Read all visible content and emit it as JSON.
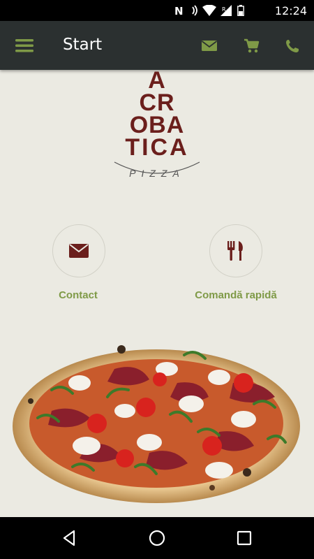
{
  "status_bar": {
    "time": "12:24",
    "icons": [
      "nfc-icon",
      "wifi-icon",
      "signal-roaming-icon",
      "battery-icon"
    ],
    "roaming_letter": "R"
  },
  "app_bar": {
    "title": "Start",
    "actions": [
      "mail-icon",
      "cart-icon",
      "phone-icon"
    ]
  },
  "logo": {
    "lines": [
      "A",
      "CR",
      "OBA",
      "TICA"
    ],
    "subtitle": "PIZZA"
  },
  "shortcuts": [
    {
      "icon": "envelope-icon",
      "label": "Contact"
    },
    {
      "icon": "cutlery-icon",
      "label": "Comandă rapidă"
    }
  ],
  "colors": {
    "app_bar": "#2b3030",
    "accent_green": "#7f9a47",
    "brand_maroon": "#6b1f1c",
    "background": "#ebeae2"
  },
  "nav_bar": {
    "buttons": [
      "back-icon",
      "home-icon",
      "recents-icon"
    ]
  }
}
